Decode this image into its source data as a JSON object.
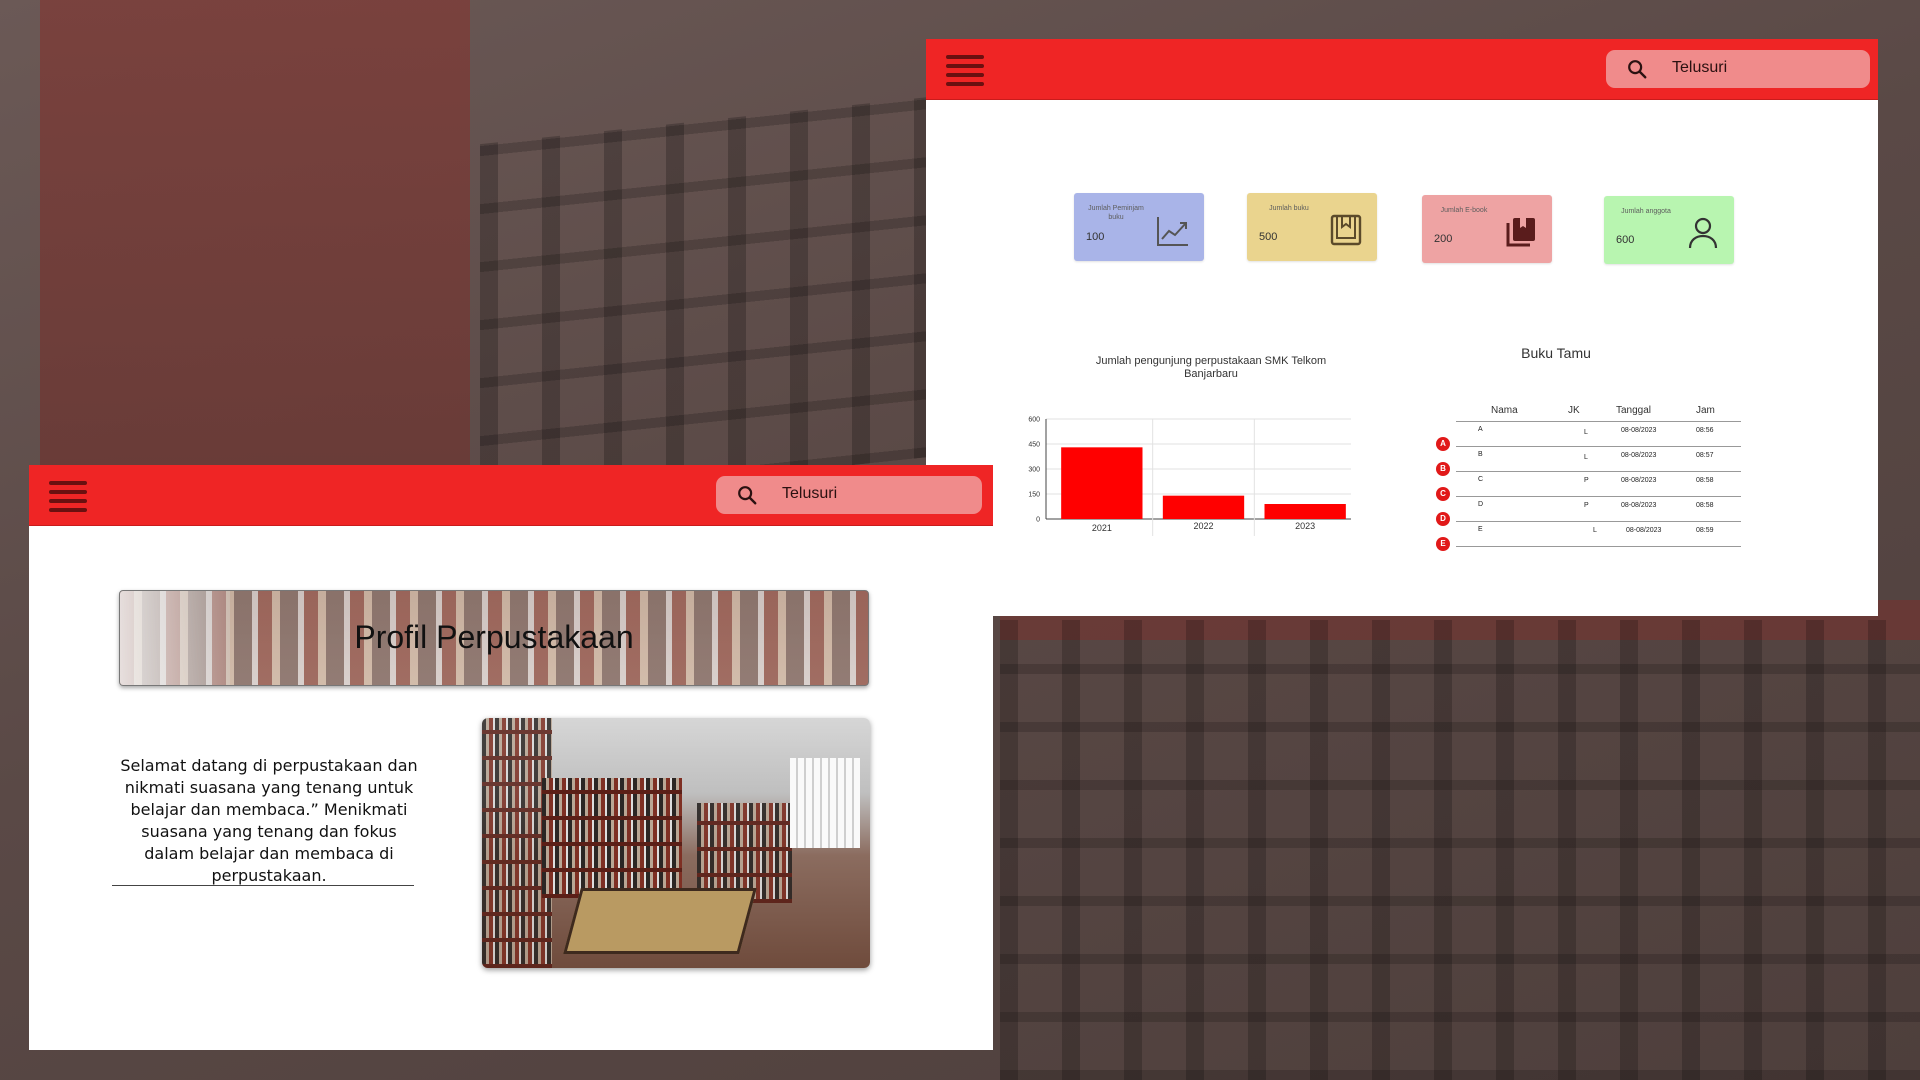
{
  "search": {
    "placeholder": "Telusuri"
  },
  "stats": [
    {
      "label": "Jumlah Peminjam buku",
      "value": "100",
      "color": "#a9b4e8",
      "icon": "trending-up-icon"
    },
    {
      "label": "Jumlah buku",
      "value": "500",
      "color": "#ead48e",
      "icon": "bookmark-book-icon"
    },
    {
      "label": "Jumlah E-book",
      "value": "200",
      "color": "#eea3a3",
      "icon": "book-stack-icon"
    },
    {
      "label": "Jumlah anggota",
      "value": "600",
      "color": "#b8f5b0",
      "icon": "user-icon"
    }
  ],
  "chart_data": {
    "type": "bar",
    "title": "Jumlah pengunjung perpustakaan SMK Telkom Banjarbaru",
    "categories": [
      "2021",
      "2022",
      "2023"
    ],
    "values": [
      430,
      140,
      90
    ],
    "ylim": [
      0,
      600
    ],
    "yticks": [
      "0",
      "150",
      "300",
      "450",
      "600"
    ],
    "color": "#ff0000",
    "grid": true
  },
  "guestbook": {
    "title": "Buku Tamu",
    "columns": [
      "Nama",
      "JK",
      "Tanggal",
      "Jam"
    ],
    "rows": [
      {
        "badge": "A",
        "nama": "A",
        "jk": "L",
        "tanggal": "08-08/2023",
        "jam": "08:56"
      },
      {
        "badge": "B",
        "nama": "B",
        "jk": "L",
        "tanggal": "08-08/2023",
        "jam": "08:57"
      },
      {
        "badge": "C",
        "nama": "C",
        "jk": "P",
        "tanggal": "08-08/2023",
        "jam": "08:58"
      },
      {
        "badge": "D",
        "nama": "D",
        "jk": "P",
        "tanggal": "08-08/2023",
        "jam": "08:58"
      },
      {
        "badge": "E",
        "nama": "E",
        "jk": "L",
        "tanggal": "08-08/2023",
        "jam": "08:59"
      }
    ]
  },
  "profile": {
    "title": "Profil Perpustakaan",
    "intro": "Selamat datang di perpustakaan dan nikmati suasana yang tenang untuk belajar dan membaca.” Menikmati suasana yang tenang dan fokus dalam belajar dan membaca di perpustakaan."
  },
  "colors": {
    "topbar": "#ef2525",
    "search_bg": "#f08b8b",
    "hamburger": "#6b1010"
  }
}
